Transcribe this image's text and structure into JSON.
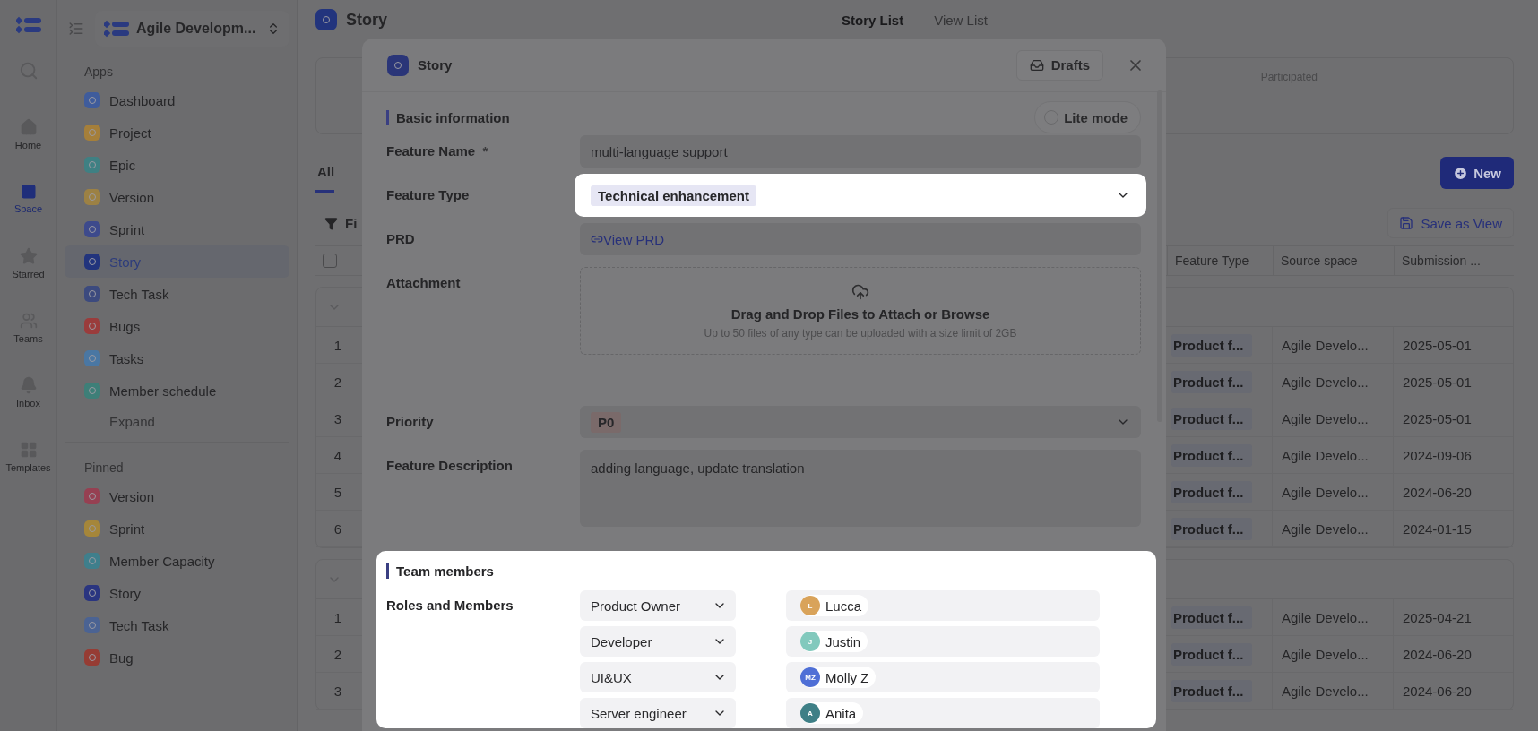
{
  "rail": {
    "items": [
      {
        "kind": "home",
        "label": "Home",
        "selected": false
      },
      {
        "kind": "space",
        "label": "Space",
        "selected": true
      },
      {
        "kind": "starred",
        "label": "Starred",
        "selected": false
      },
      {
        "kind": "teams",
        "label": "Teams",
        "selected": false
      },
      {
        "kind": "inbox",
        "label": "Inbox",
        "selected": false
      },
      {
        "kind": "templates",
        "label": "Templates",
        "selected": false
      }
    ]
  },
  "sidebar": {
    "workspace": "Agile Developm...",
    "apps_label": "Apps",
    "apps": [
      {
        "label": "Dashboard",
        "color": "#3f5c9c",
        "selected": false
      },
      {
        "label": "Project",
        "color": "#a57f3a",
        "selected": false
      },
      {
        "label": "Epic",
        "color": "#3f8083",
        "selected": false
      },
      {
        "label": "Version",
        "color": "#9c8144",
        "selected": false
      },
      {
        "label": "Sprint",
        "color": "#3d4a8c",
        "selected": false
      },
      {
        "label": "Story",
        "color": "#22347d",
        "selected": true
      },
      {
        "label": "Tech Task",
        "color": "#3c4a7e",
        "selected": false
      },
      {
        "label": "Bugs",
        "color": "#9a3c3c",
        "selected": false
      },
      {
        "label": "Tasks",
        "color": "#4a77a3",
        "selected": false
      },
      {
        "label": "Member schedule",
        "color": "#3e7f78",
        "selected": false
      }
    ],
    "expand": "Expand",
    "pinned_label": "Pinned",
    "pinned": [
      {
        "label": "Version",
        "color": "#964052",
        "selected": false
      },
      {
        "label": "Sprint",
        "color": "#a5863a",
        "selected": false
      },
      {
        "label": "Member Capacity",
        "color": "#3f7f8c",
        "selected": false
      },
      {
        "label": "Story",
        "color": "#2a3580",
        "selected": false
      },
      {
        "label": "Tech Task",
        "color": "#4b6393",
        "selected": false
      },
      {
        "label": "Bug",
        "color": "#963c34",
        "selected": false
      }
    ]
  },
  "main": {
    "title": "Story",
    "tabs": [
      {
        "label": "Story List",
        "selected": true
      },
      {
        "label": "View List",
        "selected": false
      }
    ],
    "summary": {
      "label": "Participated"
    },
    "view_tabs": [
      {
        "label": "All",
        "selected": true
      }
    ],
    "new_button": "New",
    "filter": "Fi",
    "save_view": "Save as View",
    "table": {
      "select_all": {
        "checked": false
      },
      "columns": [
        "Feature Type",
        "Source space",
        "Submission ..."
      ],
      "groups": [
        {
          "expanded": true,
          "rows": [
            {
              "index": "1",
              "feature_type": "Product f...",
              "source_space": "Agile Develo...",
              "submission": "2025-05-01"
            },
            {
              "index": "2",
              "feature_type": "Product f...",
              "source_space": "Agile Develo...",
              "submission": "2025-05-01"
            },
            {
              "index": "3",
              "feature_type": "Product f...",
              "source_space": "Agile Develo...",
              "submission": "2025-05-01"
            },
            {
              "index": "4",
              "feature_type": "Product f...",
              "source_space": "Agile Develo...",
              "submission": "2024-09-06"
            },
            {
              "index": "5",
              "feature_type": "Product f...",
              "source_space": "Agile Develo...",
              "submission": "2024-06-20"
            },
            {
              "index": "6",
              "feature_type": "Product f...",
              "source_space": "Agile Develo...",
              "submission": "2024-01-15"
            }
          ]
        },
        {
          "expanded": true,
          "rows": [
            {
              "index": "1",
              "feature_type": "Product f...",
              "source_space": "Agile Develo...",
              "submission": "2025-04-21"
            },
            {
              "index": "2",
              "feature_type": "Product f...",
              "source_space": "Agile Develo...",
              "submission": "2024-06-20"
            },
            {
              "index": "3",
              "feature_type": "Product f...",
              "source_space": "Agile Develo...",
              "submission": "2024-06-20"
            }
          ]
        }
      ]
    }
  },
  "modal": {
    "title": "Story",
    "drafts": "Drafts",
    "section": "Basic information",
    "lite_mode": {
      "label": "Lite mode",
      "on": false
    },
    "fields": [
      {
        "kind": "text",
        "label": "Feature Name",
        "required_mark": "*",
        "value": "multi-language support",
        "highlighted": false
      },
      {
        "kind": "select",
        "label": "Feature Type",
        "value": "Technical enhancement",
        "color": "#e6e6f4",
        "highlighted": true
      },
      {
        "kind": "link",
        "label": "PRD",
        "value": "View PRD",
        "highlighted": false
      },
      {
        "kind": "upload",
        "label": "Attachment",
        "value": "Drag and Drop Files to Attach or Browse",
        "hint": "Up to 50 files of any type can be uploaded with a size limit of 2GB",
        "highlighted": false
      },
      {
        "kind": "select",
        "label": "Priority",
        "value": "P0",
        "color": "#7a6a6a",
        "highlighted": false
      },
      {
        "kind": "textarea",
        "label": "Feature Description",
        "value": "adding language, update translation",
        "highlighted": false
      }
    ],
    "team": {
      "title": "Team members",
      "highlighted": true,
      "label": "Roles and Members",
      "roles": [
        {
          "role": "Product Owner",
          "member": "Lucca",
          "initials": "L",
          "color": "#d9a35a"
        },
        {
          "role": "Developer",
          "member": "Justin",
          "initials": "J",
          "color": "#82c9bd"
        },
        {
          "role": "UI&UX",
          "member": "Molly Z",
          "initials": "MZ",
          "color": "#4f6fd6"
        },
        {
          "role": "Server engineer",
          "member": "Anita",
          "initials": "A",
          "color": "#3e7f86"
        }
      ]
    }
  }
}
